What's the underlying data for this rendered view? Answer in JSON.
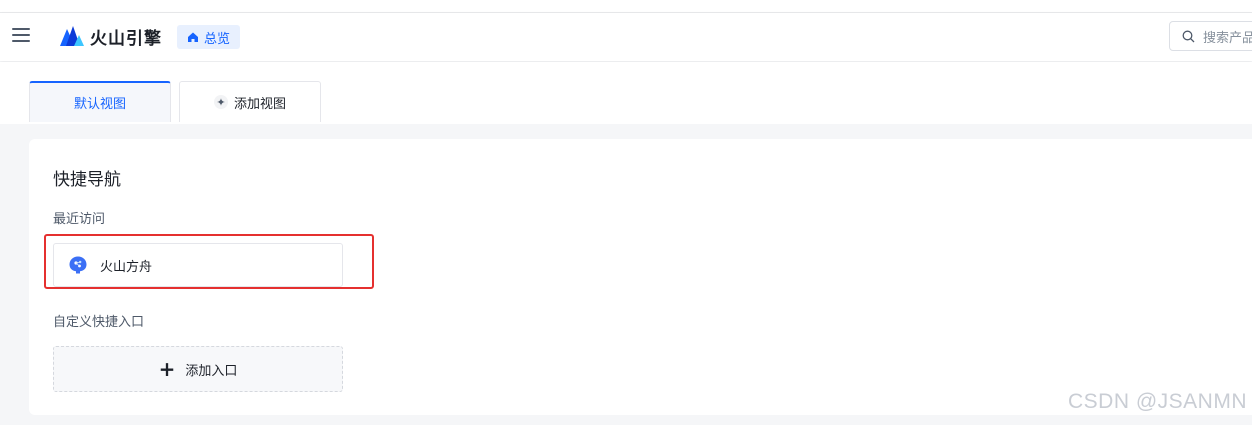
{
  "header": {
    "logo_text": "火山引擎",
    "overview_label": "总览",
    "search_placeholder": "搜索产品"
  },
  "tabs": [
    {
      "label": "默认视图",
      "active": true
    },
    {
      "label": "添加视图",
      "active": false
    }
  ],
  "quick_nav": {
    "title": "快捷导航",
    "recent_label": "最近访问",
    "recent_items": [
      {
        "label": "火山方舟",
        "icon": "volcano-ark-icon"
      }
    ],
    "custom_label": "自定义快捷入口",
    "add_entry_label": "添加入口"
  },
  "watermark": "CSDN @JSANMN",
  "colors": {
    "accent": "#1664ff",
    "highlight": "#e5302f"
  }
}
